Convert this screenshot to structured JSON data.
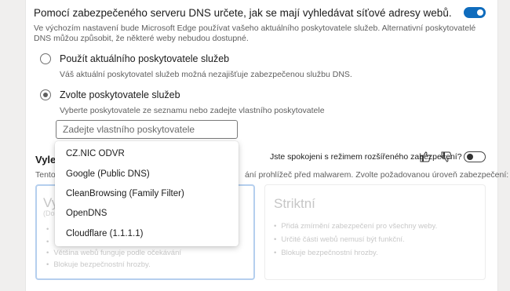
{
  "dns": {
    "title": "Pomocí zabezpečeného serveru DNS určete, jak se mají vyhledávat síťové adresy webů.",
    "enabled": true,
    "description": "Ve výchozím nastavení bude Microsoft Edge používat vašeho aktuálního poskytovatele služeb. Alternativní poskytovatelé DNS můžou způsobit, že některé weby nebudou dostupné.",
    "option_current_label": "Použít aktuálního poskytovatele služeb",
    "option_current_desc": "Váš aktuální poskytovatel služeb možná nezajišťuje zabezpečenou službu DNS.",
    "option_choose_label": "Zvolte poskytovatele služeb",
    "option_choose_desc": "Vyberte poskytovatele ze seznamu nebo zadejte vlastního poskytovatele",
    "selected_option": "choose",
    "provider_placeholder": "Zadejte vlastního poskytovatele",
    "providers": [
      "CZ.NIC ODVR",
      "Google (Public DNS)",
      "CleanBrowsing (Family Filter)",
      "OpenDNS",
      "Cloudflare (1.1.1.1)"
    ]
  },
  "security": {
    "title_partial": "Vylep",
    "desc_left": "Tento r",
    "desc_right": "ání prohlížeč před malwarem. Zvolte požadovanou úroveň zabezpečení:",
    "feedback_question": "Jste spokojeni s režimem rozšířeného zabezpečení?",
    "enabled": false,
    "levels": {
      "balanced": {
        "name_partial": "Vy",
        "sub_partial": "(Dop",
        "bullets": [
          "",
          "",
          "Většina webů funguje podle očekávání",
          "Blokuje bezpečnostní hrozby."
        ]
      },
      "strict": {
        "name": "Striktní",
        "bullets": [
          "Přidá zmírnění zabezpečení pro všechny weby.",
          "Určité části webů nemusí být funkční.",
          "Blokuje bezpečnostní hrozby."
        ]
      }
    }
  },
  "colors": {
    "accent": "#0f6cbd",
    "muted": "#5f5f5f"
  }
}
